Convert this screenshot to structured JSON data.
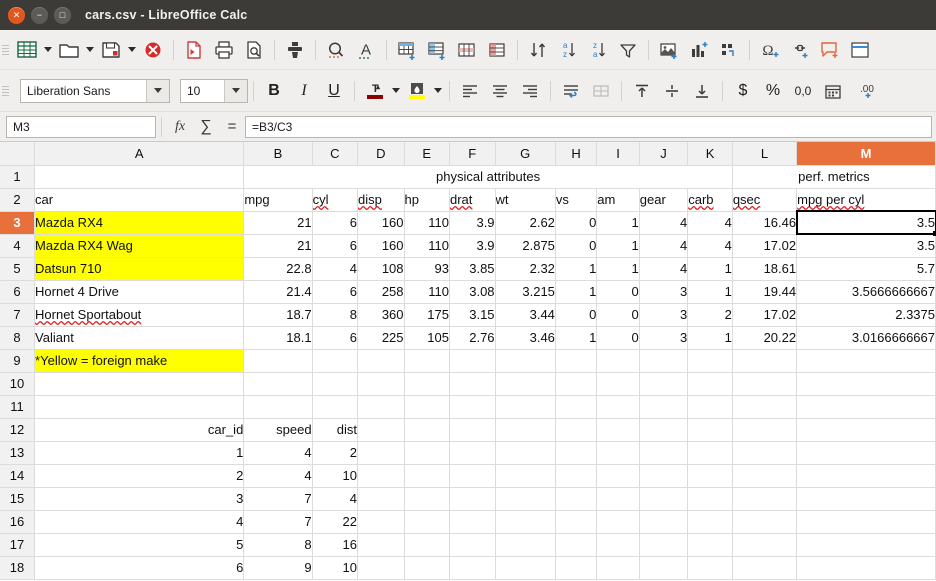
{
  "window": {
    "title": "cars.csv - LibreOffice Calc",
    "controls": [
      "close",
      "minimize",
      "maximize"
    ],
    "titlebar_color": "#3c3b37",
    "close_color": "#e2571e"
  },
  "toolbar": {
    "items": [
      {
        "name": "new-document-icon",
        "label": "New"
      },
      {
        "name": "new-document-dropdown",
        "label": ""
      },
      {
        "name": "open-folder-icon",
        "label": "Open"
      },
      {
        "name": "open-dropdown",
        "label": ""
      },
      {
        "name": "save-icon",
        "label": "Save"
      },
      {
        "name": "save-dropdown",
        "label": ""
      },
      {
        "name": "sep",
        "label": ""
      },
      {
        "name": "export-pdf-icon",
        "label": "Export as PDF"
      },
      {
        "name": "print-icon",
        "label": "Print"
      },
      {
        "name": "print-preview-icon",
        "label": "Print Preview"
      },
      {
        "name": "sep",
        "label": ""
      },
      {
        "name": "clone-formatting-icon",
        "label": "Clone Formatting"
      },
      {
        "name": "sep",
        "label": ""
      },
      {
        "name": "find-replace-icon",
        "label": "Find and Replace"
      },
      {
        "name": "spelling-icon",
        "label": "Spelling"
      },
      {
        "name": "sep",
        "label": ""
      },
      {
        "name": "insert-table-icon",
        "label": "Insert Table"
      },
      {
        "name": "insert-row-icon",
        "label": "Insert Row"
      },
      {
        "name": "insert-column-icon",
        "label": "Insert Column"
      },
      {
        "name": "delete-row-icon",
        "label": "Delete Row"
      },
      {
        "name": "sep",
        "label": ""
      },
      {
        "name": "sort-icon",
        "label": "Sort"
      },
      {
        "name": "sort-ascending-icon",
        "label": "Sort Ascending"
      },
      {
        "name": "sort-descending-icon",
        "label": "Sort Descending"
      },
      {
        "name": "autofilter-icon",
        "label": "AutoFilter"
      },
      {
        "name": "sep",
        "label": ""
      },
      {
        "name": "insert-image-icon",
        "label": "Insert Image"
      },
      {
        "name": "insert-chart-icon",
        "label": "Insert Chart"
      },
      {
        "name": "pivot-table-icon",
        "label": "Pivot Table"
      },
      {
        "name": "sep",
        "label": ""
      },
      {
        "name": "special-character-icon",
        "label": "Special Character"
      },
      {
        "name": "hyperlink-icon",
        "label": "Insert Hyperlink"
      },
      {
        "name": "comment-icon",
        "label": "Insert Comment"
      },
      {
        "name": "header-footer-icon",
        "label": "Headers and Footers"
      }
    ]
  },
  "formatbar": {
    "font_name": "Liberation Sans",
    "font_size": "10",
    "bold_label": "B",
    "italic_label": "I",
    "underline_label": "U",
    "font_color": "#8b0000",
    "highlight_color": "#ffff00",
    "buttons": [
      {
        "name": "align-left-icon",
        "label": "Align Left"
      },
      {
        "name": "align-center-icon",
        "label": "Align Center"
      },
      {
        "name": "align-right-icon",
        "label": "Align Right"
      },
      {
        "name": "wrap-text-icon",
        "label": "Wrap Text"
      },
      {
        "name": "merge-cells-icon",
        "label": "Merge Cells"
      },
      {
        "name": "align-top-icon",
        "label": "Align Top"
      },
      {
        "name": "align-middle-icon",
        "label": "Center Vertically"
      },
      {
        "name": "align-bottom-icon",
        "label": "Align Bottom"
      },
      {
        "name": "format-currency-icon",
        "label": "Currency"
      },
      {
        "name": "format-percent-icon",
        "label": "Percent"
      },
      {
        "name": "format-number-icon",
        "label": "Number"
      },
      {
        "name": "format-date-icon",
        "label": "Date"
      },
      {
        "name": "add-decimal-icon",
        "label": "Add Decimal Place"
      }
    ]
  },
  "formulabar": {
    "name_box": "M3",
    "function_wizard": "fx",
    "sum": "∑",
    "equals": "=",
    "formula": "=B3/C3"
  },
  "grid": {
    "columns": [
      "A",
      "B",
      "C",
      "D",
      "E",
      "F",
      "G",
      "H",
      "I",
      "J",
      "K",
      "L",
      "M"
    ],
    "selected_column": "M",
    "selected_row": "3",
    "selected_cell": "M3",
    "rows": [
      "1",
      "2",
      "3",
      "4",
      "5",
      "6",
      "7",
      "8",
      "9",
      "10",
      "11",
      "12",
      "13",
      "14",
      "15",
      "16",
      "17",
      "18"
    ],
    "group_headers": {
      "physical_attributes": "physical attributes",
      "perf_metrics": "perf. metrics"
    },
    "table1_headers": [
      "car",
      "mpg",
      "cyl",
      "disp",
      "hp",
      "drat",
      "wt",
      "vs",
      "am",
      "gear",
      "carb",
      "qsec",
      "mpg per cyl"
    ],
    "table1_rows": [
      {
        "row": "3",
        "cells": [
          "Mazda RX4",
          "21",
          "6",
          "160",
          "110",
          "3.9",
          "2.62",
          "0",
          "1",
          "4",
          "4",
          "16.46",
          "3.5"
        ],
        "highlight": true
      },
      {
        "row": "4",
        "cells": [
          "Mazda RX4 Wag",
          "21",
          "6",
          "160",
          "110",
          "3.9",
          "2.875",
          "0",
          "1",
          "4",
          "4",
          "17.02",
          "3.5"
        ],
        "highlight": true
      },
      {
        "row": "5",
        "cells": [
          "Datsun 710",
          "22.8",
          "4",
          "108",
          "93",
          "3.85",
          "2.32",
          "1",
          "1",
          "4",
          "1",
          "18.61",
          "5.7"
        ],
        "highlight": true
      },
      {
        "row": "6",
        "cells": [
          "Hornet 4 Drive",
          "21.4",
          "6",
          "258",
          "110",
          "3.08",
          "3.215",
          "1",
          "0",
          "3",
          "1",
          "19.44",
          "3.5666666667"
        ],
        "highlight": false
      },
      {
        "row": "7",
        "cells": [
          "Hornet Sportabout",
          "18.7",
          "8",
          "360",
          "175",
          "3.15",
          "3.44",
          "0",
          "0",
          "3",
          "2",
          "17.02",
          "2.3375"
        ],
        "highlight": false
      },
      {
        "row": "8",
        "cells": [
          "Valiant",
          "18.1",
          "6",
          "225",
          "105",
          "2.76",
          "3.46",
          "1",
          "0",
          "3",
          "1",
          "20.22",
          "3.0166666667"
        ],
        "highlight": false
      }
    ],
    "note_row": {
      "row": "9",
      "text": "*Yellow = foreign make",
      "highlight": true
    },
    "table2_headers": [
      "car_id",
      "speed",
      "dist"
    ],
    "table2_rows": [
      {
        "row": "13",
        "cells": [
          "1",
          "4",
          "2"
        ]
      },
      {
        "row": "14",
        "cells": [
          "2",
          "4",
          "10"
        ]
      },
      {
        "row": "15",
        "cells": [
          "3",
          "7",
          "4"
        ]
      },
      {
        "row": "16",
        "cells": [
          "4",
          "7",
          "22"
        ]
      },
      {
        "row": "17",
        "cells": [
          "5",
          "8",
          "16"
        ]
      },
      {
        "row": "18",
        "cells": [
          "6",
          "9",
          "10"
        ]
      }
    ]
  }
}
